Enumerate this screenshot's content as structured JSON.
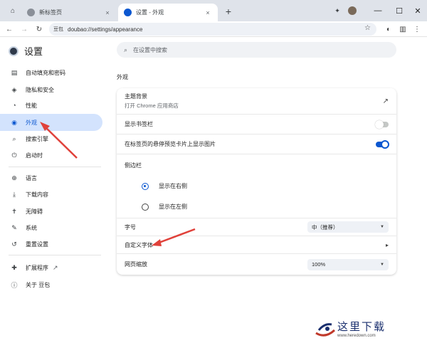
{
  "tabs": [
    {
      "title": "新标签页",
      "close": "×"
    },
    {
      "title": "设置 - 外观",
      "close": "×"
    }
  ],
  "new_tab": "+",
  "window_controls": {
    "minimize": "—",
    "maximize": "☐",
    "close": "✕"
  },
  "toolbar": {
    "chip": "豆包",
    "url": "doubao://settings/appearance"
  },
  "sidebar": {
    "title": "设置",
    "items": [
      {
        "label": "自动填充和密码",
        "icon": "clipboard-icon",
        "glyph": "▤"
      },
      {
        "label": "隐私和安全",
        "icon": "shield-icon",
        "glyph": "◈"
      },
      {
        "label": "性能",
        "icon": "speedometer-icon",
        "glyph": "◔"
      },
      {
        "label": "外观",
        "icon": "palette-icon",
        "glyph": "◉"
      },
      {
        "label": "搜索引擎",
        "icon": "search-icon",
        "glyph": "⌕"
      },
      {
        "label": "启动时",
        "icon": "power-icon",
        "glyph": "⏻"
      },
      {
        "label": "语言",
        "icon": "globe-icon",
        "glyph": "⊕"
      },
      {
        "label": "下载内容",
        "icon": "download-icon",
        "glyph": "⤓"
      },
      {
        "label": "无障碍",
        "icon": "accessibility-icon",
        "glyph": "✝"
      },
      {
        "label": "系统",
        "icon": "wrench-icon",
        "glyph": "✎"
      },
      {
        "label": "重置设置",
        "icon": "reset-icon",
        "glyph": "↺"
      },
      {
        "label": "扩展程序",
        "icon": "puzzle-icon",
        "glyph": "✚"
      },
      {
        "label": "关于 豆包",
        "icon": "info-icon",
        "glyph": "ⓘ"
      }
    ]
  },
  "search": {
    "placeholder": "在设置中搜索"
  },
  "section_title": "外观",
  "settings": {
    "theme": {
      "label": "主题背景",
      "sub": "打开 Chrome 应用商店"
    },
    "bookmarks_bar": {
      "label": "显示书签栏",
      "enabled": false
    },
    "hover_preview": {
      "label": "在标签页的悬停预览卡片上显示图片",
      "enabled": true
    },
    "side_panel": {
      "label": "侧边栏",
      "option_right": "显示在右侧",
      "option_left": "显示在左侧",
      "selected": "right"
    },
    "font_size": {
      "label": "字号",
      "value": "中（推荐）"
    },
    "custom_fonts": {
      "label": "自定义字体"
    },
    "page_zoom": {
      "label": "网页缩放",
      "value": "100%"
    }
  },
  "watermark": {
    "text": "这里下载",
    "url": "www.heredown.com"
  },
  "colors": {
    "accent": "#0b57d0",
    "selected_bg": "#d3e3fd",
    "annotation_arrow": "#e0413a"
  }
}
